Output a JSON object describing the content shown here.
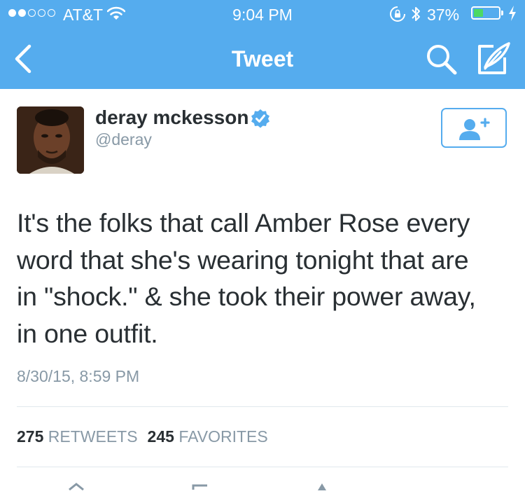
{
  "status_bar": {
    "carrier": "AT&T",
    "time": "9:04 PM",
    "battery_percent": "37%",
    "battery_level": 0.37,
    "signal_bars_filled": 2,
    "signal_bars_total": 5
  },
  "nav": {
    "title": "Tweet",
    "back_icon": "chevron-left-icon",
    "search_icon": "search-icon",
    "compose_icon": "compose-icon"
  },
  "tweet": {
    "author": {
      "name": "deray mckesson",
      "handle": "@deray",
      "verified": true
    },
    "text": "It's the folks that call Amber Rose every\nword that she's wearing tonight that are\nin \"shock.\" & she took their power away,\nin one outfit.",
    "timestamp": "8/30/15, 8:59 PM",
    "stats": {
      "retweets_count": "275",
      "retweets_label": "RETWEETS",
      "favorites_count": "245",
      "favorites_label": "FAVORITES"
    }
  },
  "colors": {
    "brand_blue": "#55acee",
    "text_dark": "#292f33",
    "text_gray": "#8899a6",
    "divider": "#e1e8ed",
    "battery_green": "#4cd964"
  }
}
